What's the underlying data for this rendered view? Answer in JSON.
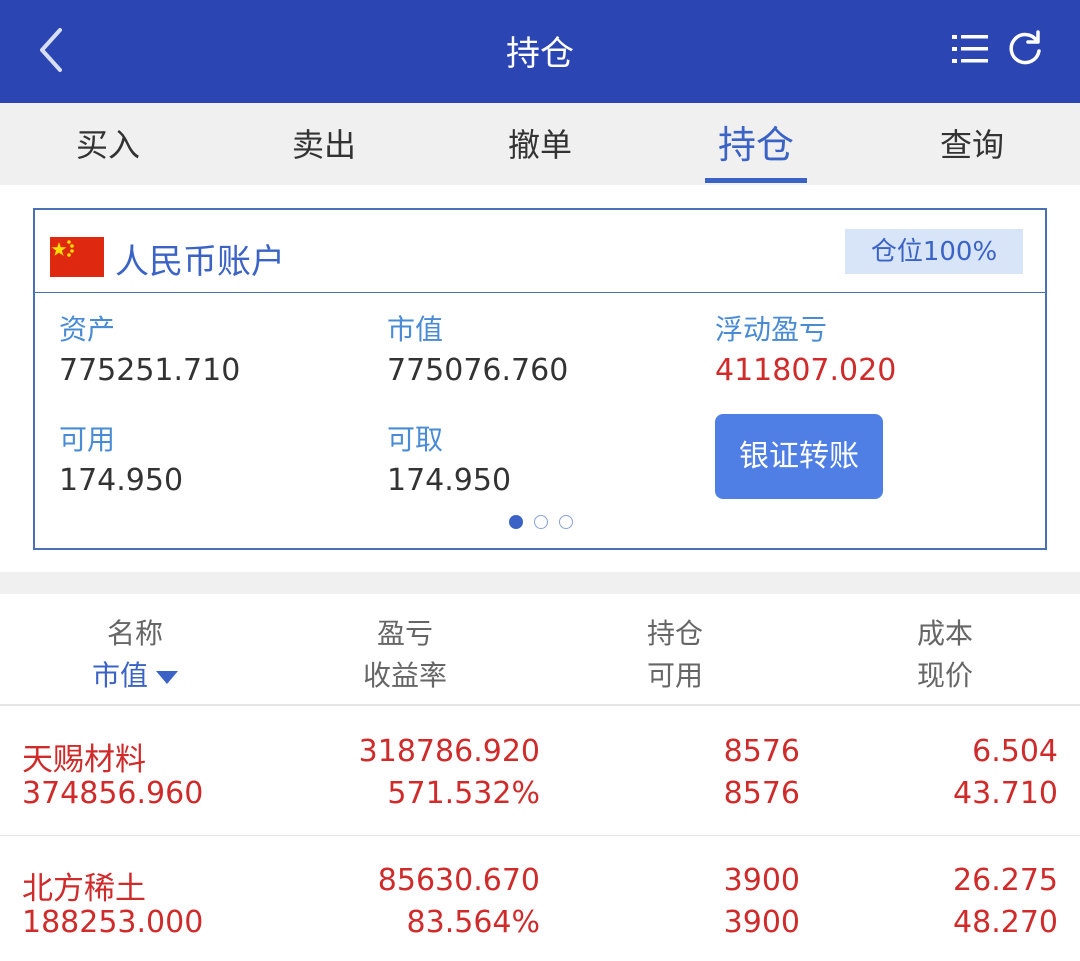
{
  "header": {
    "title": "持仓",
    "back_icon": "chevron-left-icon",
    "menu_icon": "list-icon",
    "refresh_icon": "refresh-icon"
  },
  "tabs": [
    {
      "label": "买入",
      "active": false
    },
    {
      "label": "卖出",
      "active": false
    },
    {
      "label": "撤单",
      "active": false
    },
    {
      "label": "持仓",
      "active": true
    },
    {
      "label": "查询",
      "active": false
    }
  ],
  "account": {
    "name": "人民币账户",
    "position_badge": "仓位100%",
    "fields": {
      "assets": {
        "label": "资产",
        "value": "775251.710"
      },
      "market_value": {
        "label": "市值",
        "value": "775076.760"
      },
      "floating_pl": {
        "label": "浮动盈亏",
        "value": "411807.020"
      },
      "available": {
        "label": "可用",
        "value": "174.950"
      },
      "withdrawable": {
        "label": "可取",
        "value": "174.950"
      }
    },
    "transfer_button": "银证转账",
    "page_indicator": {
      "total": 3,
      "current": 1
    }
  },
  "table": {
    "headers": [
      {
        "top": "名称",
        "bottom": "市值"
      },
      {
        "top": "盈亏",
        "bottom": "收益率"
      },
      {
        "top": "持仓",
        "bottom": "可用"
      },
      {
        "top": "成本",
        "bottom": "现价"
      }
    ],
    "rows": [
      {
        "name": "天赐材料",
        "market_value": "374856.960",
        "pl": "318786.920",
        "return_rate": "571.532%",
        "position": "8576",
        "available": "8576",
        "cost": "6.504",
        "price": "43.710"
      },
      {
        "name": "北方稀土",
        "market_value": "188253.000",
        "pl": "85630.670",
        "return_rate": "83.564%",
        "position": "3900",
        "available": "3900",
        "cost": "26.275",
        "price": "48.270"
      }
    ]
  },
  "colors": {
    "header_bg": "#2b45b2",
    "accent_blue": "#3b63c6",
    "gain_red": "#d02b2b",
    "button_blue": "#4f7fe4"
  }
}
